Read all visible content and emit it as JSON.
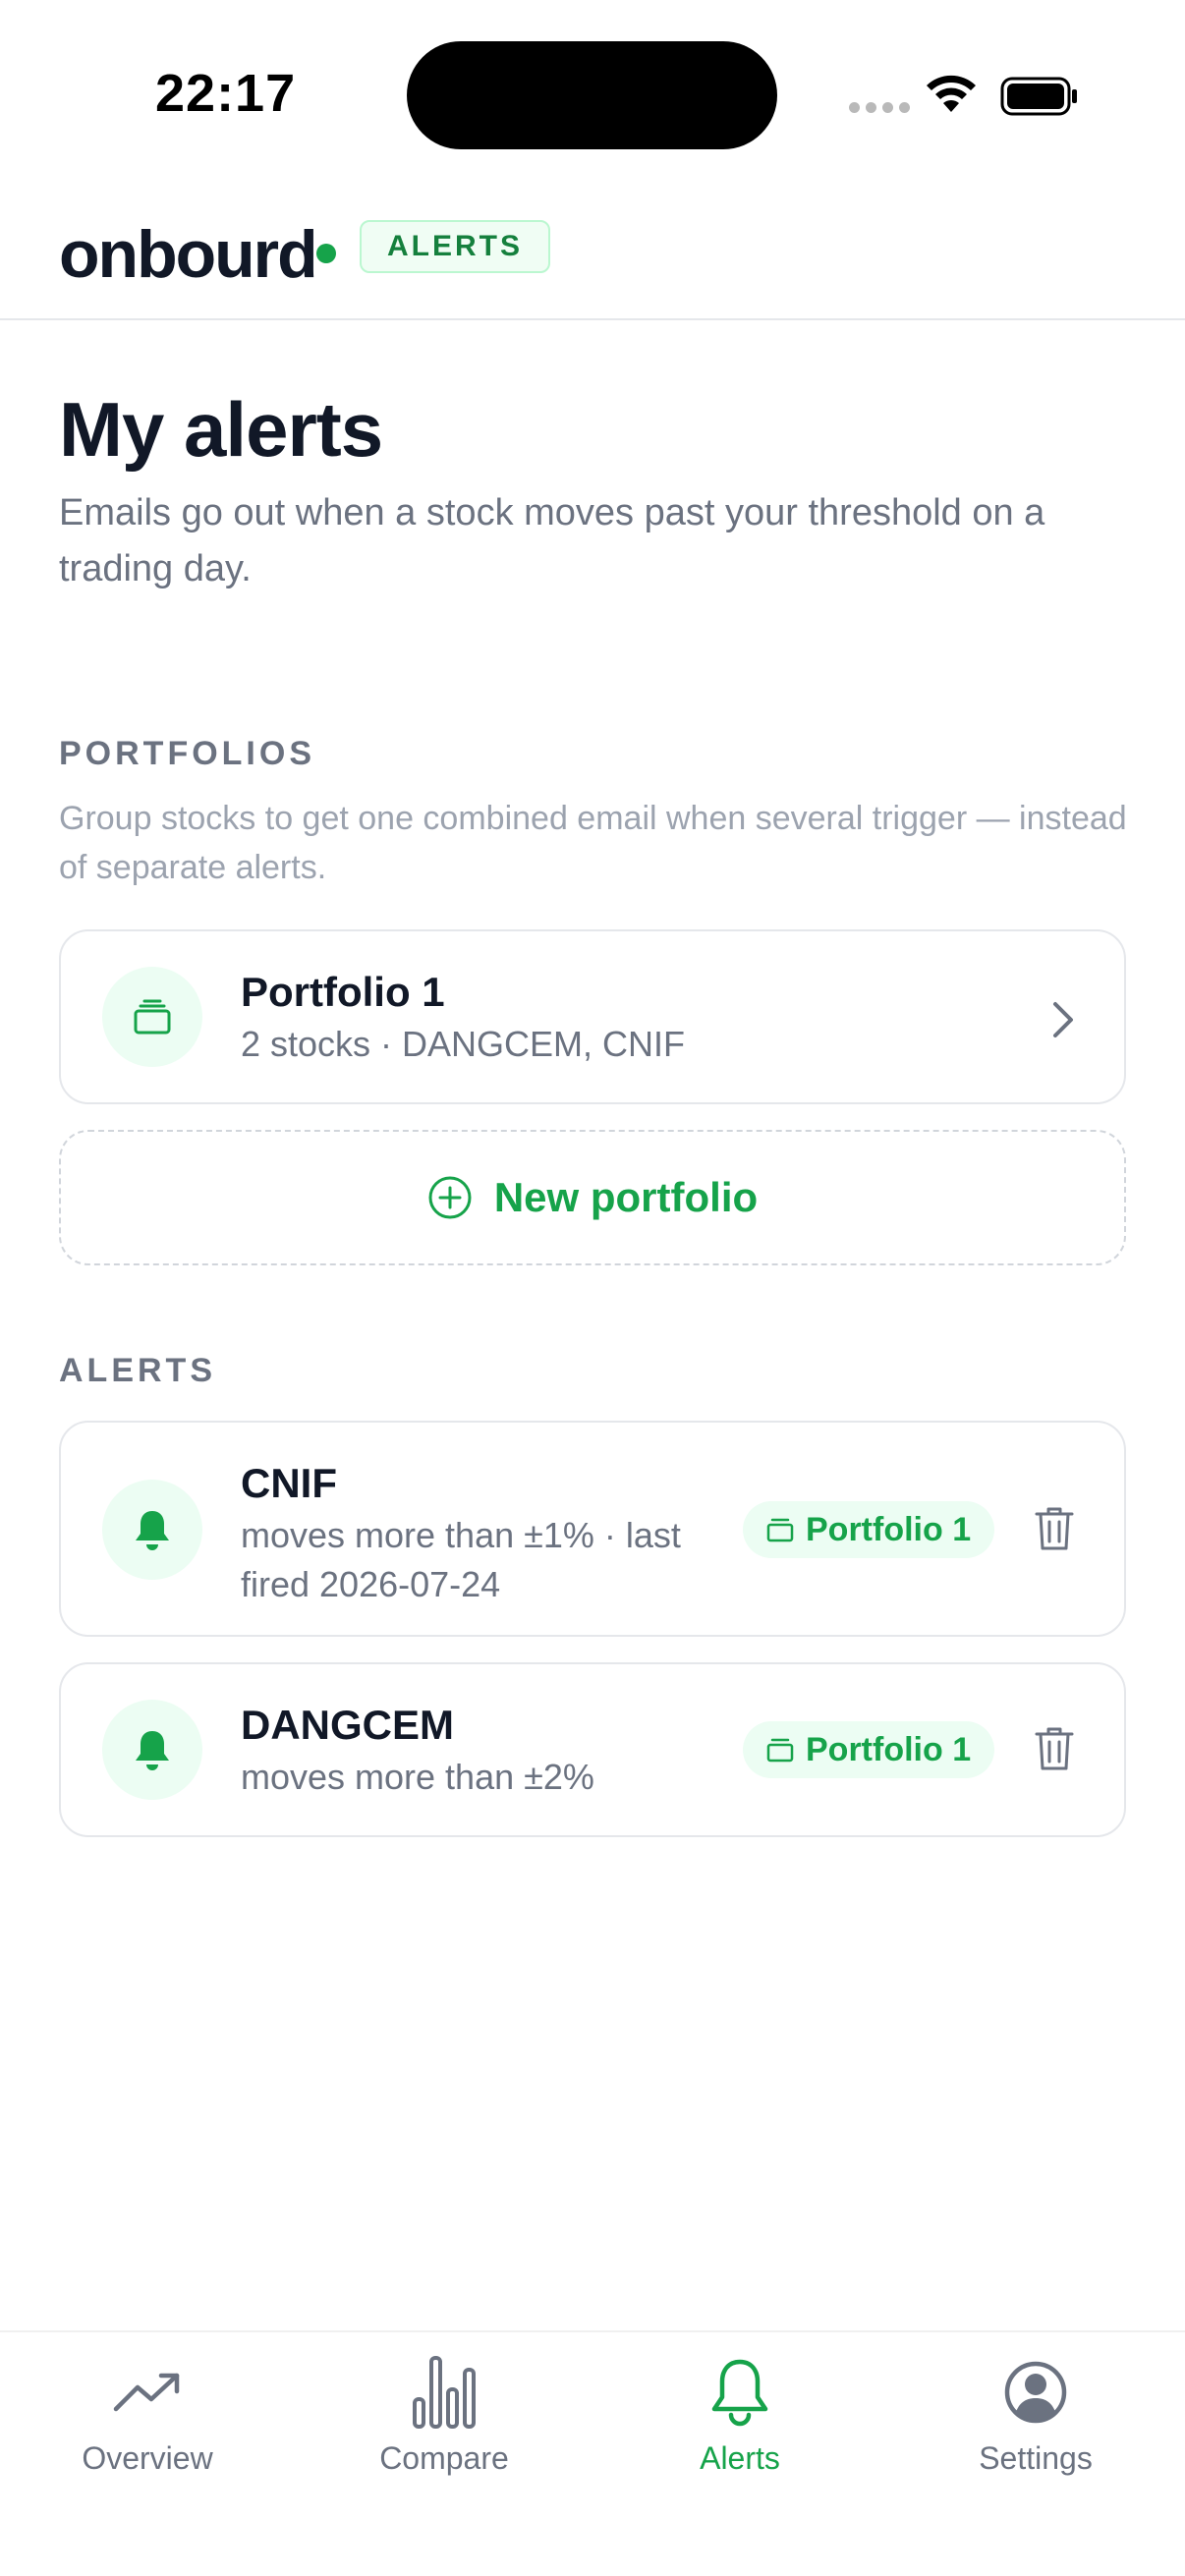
{
  "status_bar": {
    "time": "22:17"
  },
  "header": {
    "logo": "onbourd",
    "badge": "ALERTS"
  },
  "page": {
    "title": "My alerts",
    "subtitle": "Emails go out when a stock moves past your threshold on a trading day."
  },
  "portfolios_section": {
    "label": "PORTFOLIOS",
    "description": "Group stocks to get one combined email when several trigger — instead of separate alerts.",
    "items": [
      {
        "name": "Portfolio 1",
        "detail": "2 stocks · DANGCEM, CNIF"
      }
    ],
    "new_button": "New portfolio"
  },
  "alerts_section": {
    "label": "ALERTS",
    "items": [
      {
        "ticker": "CNIF",
        "detail": "moves more than ±1% · last fired 2026-07-24",
        "portfolio": "Portfolio 1"
      },
      {
        "ticker": "DANGCEM",
        "detail": "moves more than ±2%",
        "portfolio": "Portfolio 1"
      }
    ]
  },
  "bottom_nav": {
    "items": [
      {
        "label": "Overview",
        "icon": "trend-up-icon",
        "active": false
      },
      {
        "label": "Compare",
        "icon": "bar-chart-icon",
        "active": false
      },
      {
        "label": "Alerts",
        "icon": "bell-icon",
        "active": true
      },
      {
        "label": "Settings",
        "icon": "user-circle-icon",
        "active": false
      }
    ]
  },
  "colors": {
    "accent": "#16a34a",
    "accent_bg": "#ecfdf3",
    "text": "#111827",
    "muted": "#6b7280"
  }
}
